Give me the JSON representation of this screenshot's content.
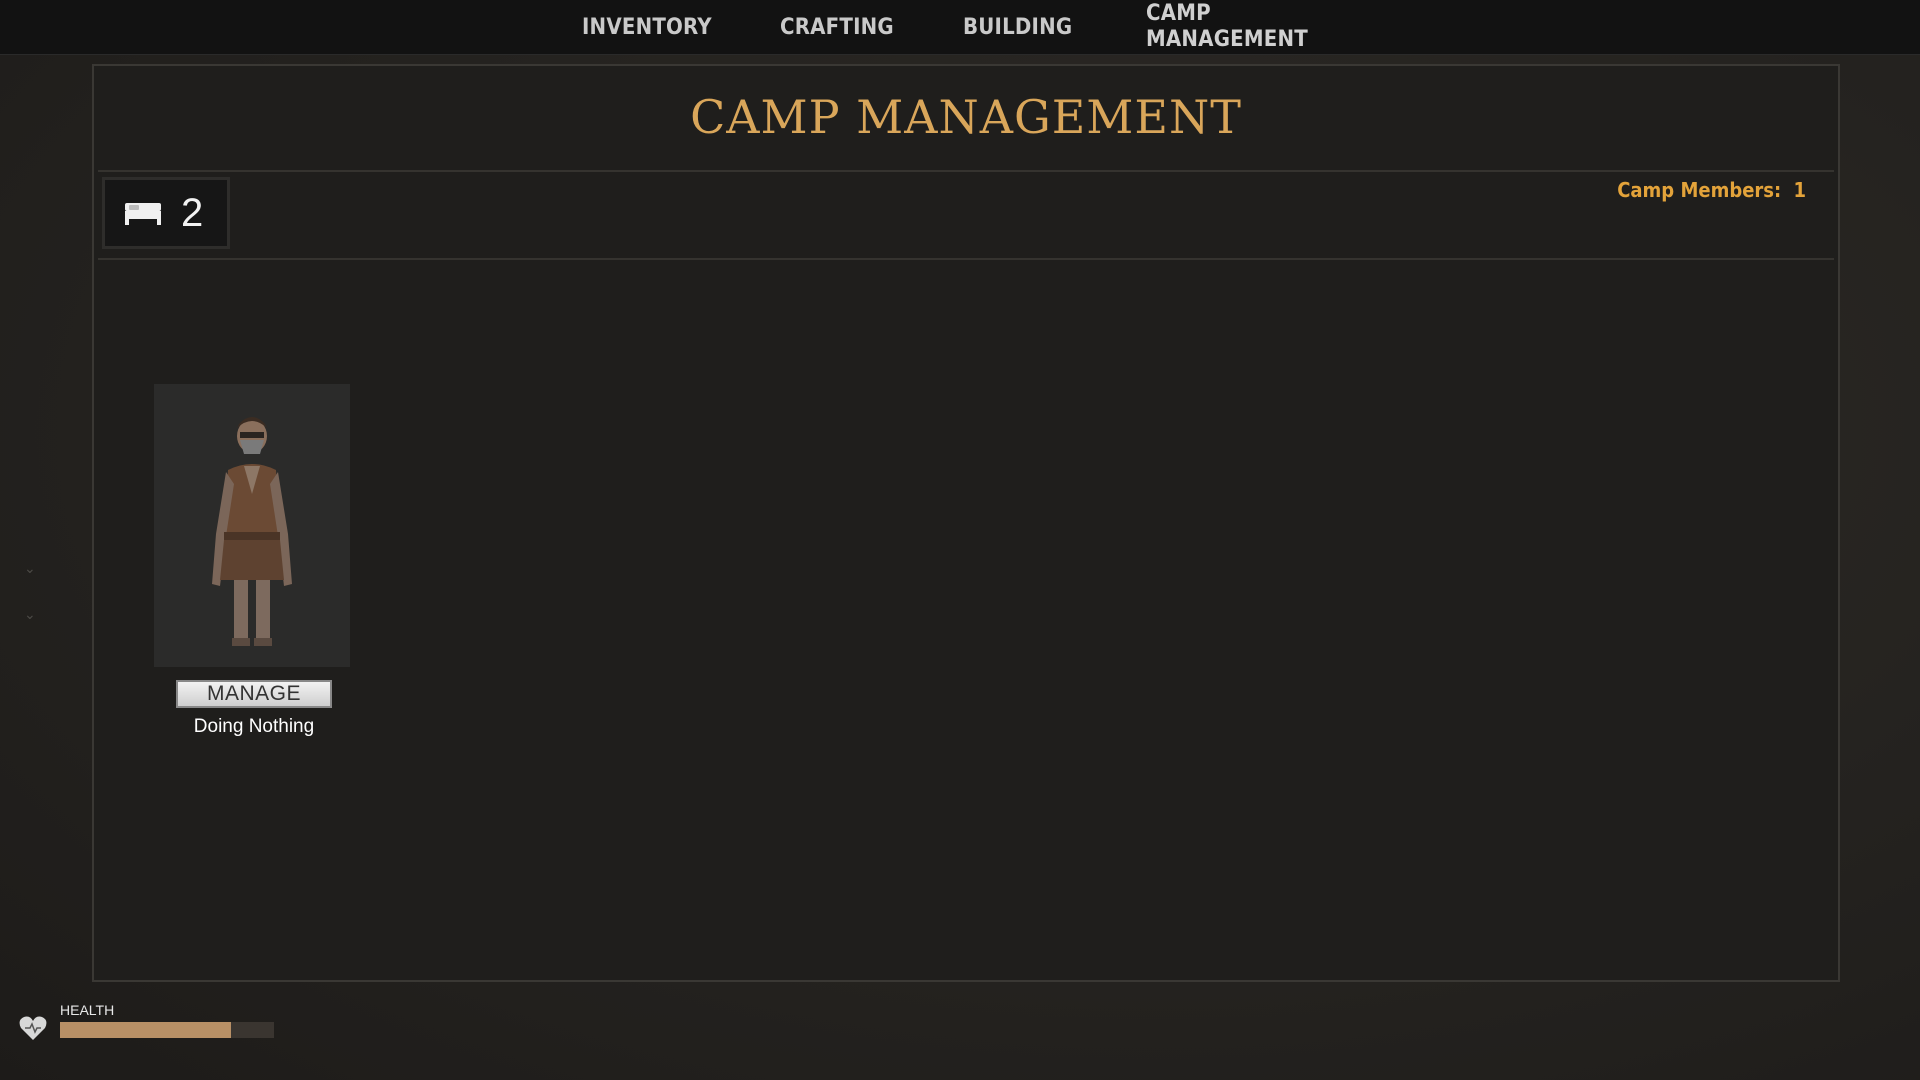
{
  "nav": {
    "tabs": [
      "INVENTORY",
      "CRAFTING",
      "BUILDING"
    ],
    "active_tab_line1": "CAMP",
    "active_tab_line2": "MANAGEMENT"
  },
  "panel": {
    "title": "CAMP MANAGEMENT",
    "beds_count": "2",
    "camp_members_label": "Camp Members:",
    "camp_members_count": "1"
  },
  "members": [
    {
      "button_label": "MANAGE",
      "status": "Doing Nothing"
    }
  ],
  "hud": {
    "health_label": "HEALTH",
    "health_fraction": 0.8
  },
  "colors": {
    "accent_title": "#d9a65a",
    "accent_members": "#e3a33a",
    "health_bar": "#b89066"
  },
  "icons": [
    "bed-icon",
    "heart-icon"
  ]
}
